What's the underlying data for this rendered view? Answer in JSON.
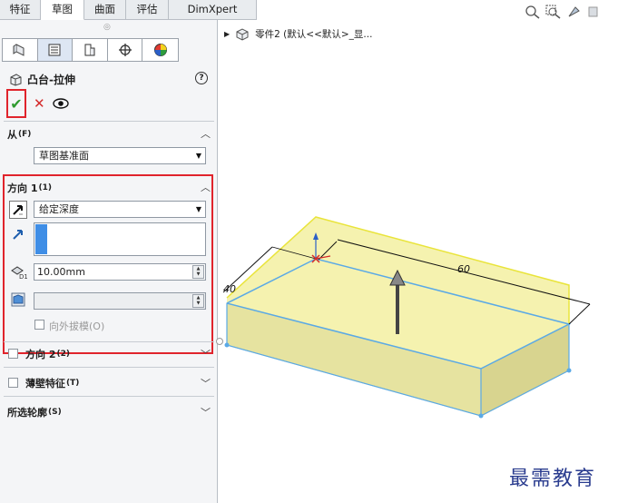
{
  "command_tabs": [
    {
      "label": "特征",
      "width": 45
    },
    {
      "label": "草图",
      "width": 48
    },
    {
      "label": "曲面",
      "width": 46
    },
    {
      "label": "评估",
      "width": 47
    },
    {
      "label": "DimXpert",
      "width": 97
    }
  ],
  "command_tabs_active": "草图",
  "manager_tabs": [
    "feature-manager-icon",
    "property-manager-icon",
    "configuration-manager-icon",
    "dimxpert-manager-icon",
    "display-manager-icon"
  ],
  "feature": {
    "title": "凸台-拉伸",
    "help": "?",
    "ok_icon": "✔",
    "cancel_icon": "✕",
    "preview_icon": "eye-icon"
  },
  "from_section": {
    "title": "从",
    "shortcut": "(F)",
    "select_value": "草图基准面"
  },
  "direction1": {
    "title": "方向 1",
    "shortcut": "(1)",
    "end_condition": "给定深度",
    "depth_value": "10.00mm",
    "draft_label": "向外拔模(O)"
  },
  "direction2": {
    "title": "方向 2",
    "shortcut": "(2)"
  },
  "thin_feature": {
    "title": "薄壁特征",
    "shortcut": "(T)"
  },
  "selected_contours": {
    "title": "所选轮廓",
    "shortcut": "(S)"
  },
  "tree": {
    "text": "零件2  (默认<<默认>_显..."
  },
  "viewport": {
    "dim_label_left": "40",
    "dim_label_right": "60"
  },
  "watermark": "最需教育",
  "colors": {
    "highlight_red": "#e0242c",
    "preview_yellow": "#f4f1a6",
    "edge_blue": "#5aa9e6",
    "ok_green": "#2f9b2f"
  }
}
